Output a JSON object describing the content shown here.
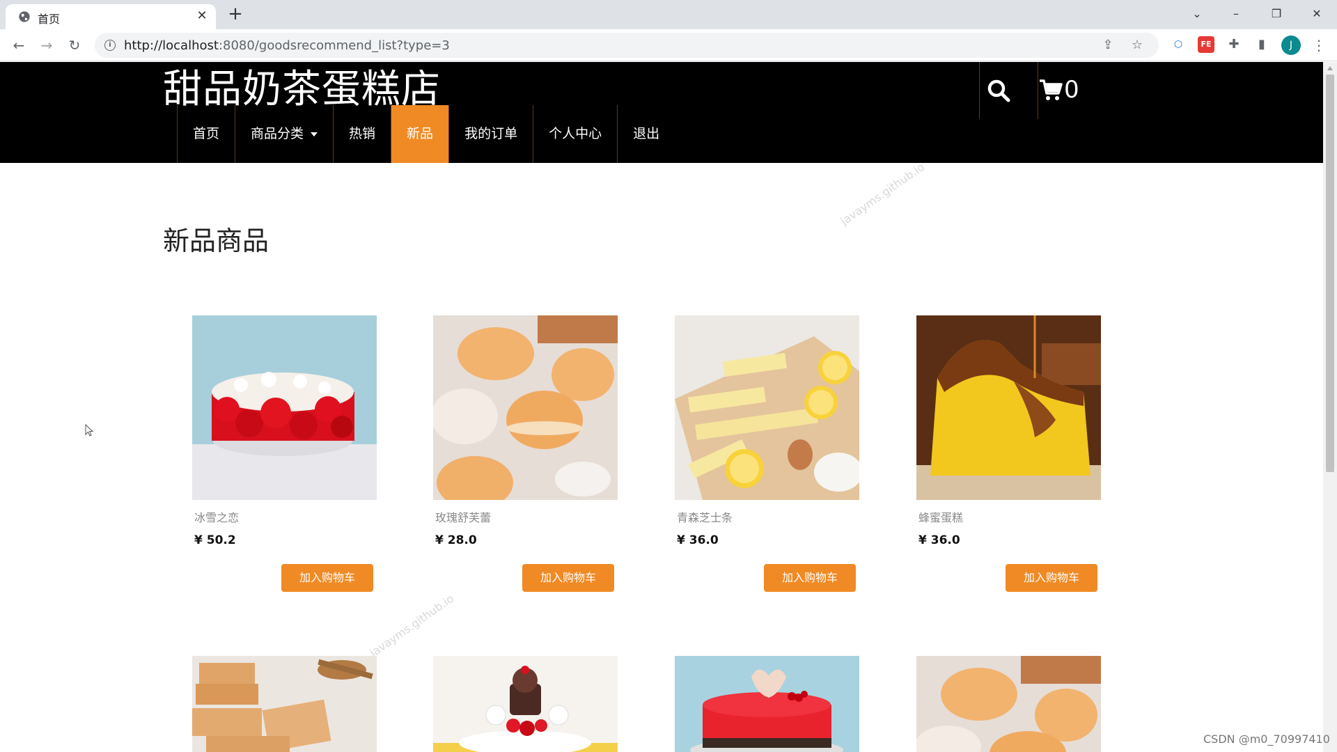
{
  "browser": {
    "tab_title": "首页",
    "url_host": "http://localhost",
    "url_rest": ":8080/goodsrecommend_list?type=3",
    "profile_initial": "J"
  },
  "site": {
    "logo": "甜品奶茶蛋糕店",
    "cart_count": "0",
    "nav": [
      {
        "label": "首页"
      },
      {
        "label": "商品分类"
      },
      {
        "label": "热销"
      },
      {
        "label": "新品"
      },
      {
        "label": "我的订单"
      },
      {
        "label": "个人中心"
      },
      {
        "label": "退出"
      }
    ],
    "active_nav": "新品",
    "accent_color": "#f08a24"
  },
  "section": {
    "title": "新品商品"
  },
  "products": [
    {
      "name": "冰雪之恋",
      "price": "¥ 50.2",
      "button": "加入购物车"
    },
    {
      "name": "玫瑰舒芙蕾",
      "price": "¥ 28.0",
      "button": "加入购物车"
    },
    {
      "name": "青森芝士条",
      "price": "¥ 36.0",
      "button": "加入购物车"
    },
    {
      "name": "蜂蜜蛋糕",
      "price": "¥ 36.0",
      "button": "加入购物车"
    }
  ],
  "watermark": "javayms.github.io",
  "footer_credit": "CSDN @m0_70997410"
}
